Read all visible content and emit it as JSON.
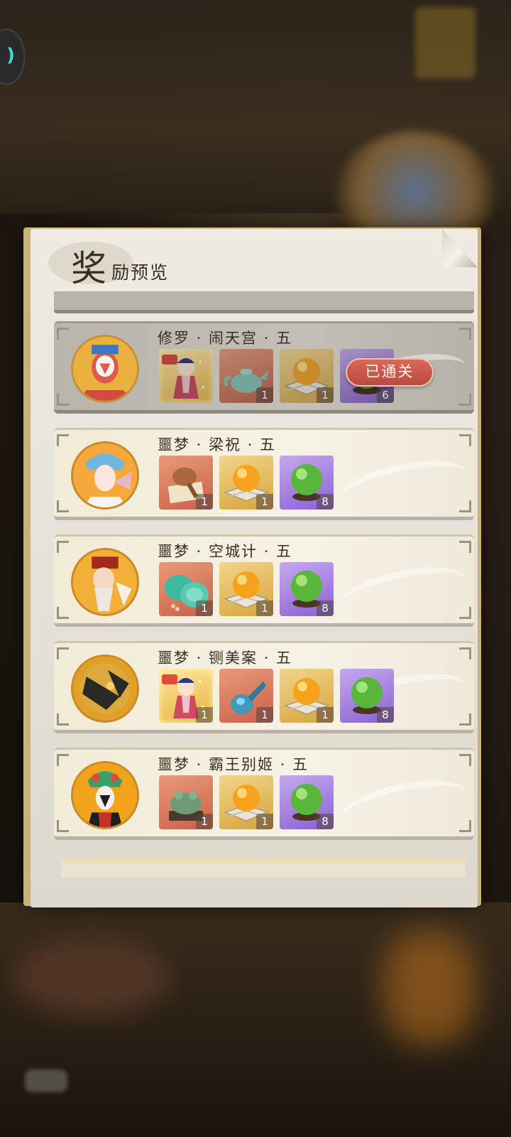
{
  "title": {
    "big_char": "奖",
    "rest": "励预览"
  },
  "back_button": {
    "glyph": ")"
  },
  "stages": [
    {
      "name": "修罗 · 闹天宫 · 五",
      "cleared": true,
      "cleared_label": "已通关",
      "avatar": "sun-wukong-opera-mask",
      "rewards": [
        {
          "icon": "opera-character-figurine",
          "rarity": "char",
          "count": ""
        },
        {
          "icon": "jade-teapot",
          "rarity": "orange",
          "count": "1"
        },
        {
          "icon": "amber-orb-on-scroll",
          "rarity": "gold",
          "count": "1"
        },
        {
          "icon": "green-jade-orb",
          "rarity": "purple",
          "count": "6"
        }
      ]
    },
    {
      "name": "噩梦 · 梁祝 · 五",
      "cleared": false,
      "avatar": "liang-zhu-opera-character",
      "rewards": [
        {
          "icon": "wooden-fan-item",
          "rarity": "orange",
          "count": "1"
        },
        {
          "icon": "amber-orb-on-scroll",
          "rarity": "gold",
          "count": "1"
        },
        {
          "icon": "green-jade-orb",
          "rarity": "purple",
          "count": "8"
        }
      ]
    },
    {
      "name": "噩梦 · 空城计 · 五",
      "cleared": false,
      "avatar": "zhuge-liang-opera-character",
      "rewards": [
        {
          "icon": "jade-discs",
          "rarity": "orange",
          "count": "1"
        },
        {
          "icon": "amber-orb-on-scroll",
          "rarity": "gold",
          "count": "1"
        },
        {
          "icon": "green-jade-orb",
          "rarity": "purple",
          "count": "8"
        }
      ]
    },
    {
      "name": "噩梦 · 铡美案 · 五",
      "cleared": false,
      "avatar": "bao-zheng-opera-character",
      "rewards": [
        {
          "icon": "opera-character-figurine",
          "rarity": "char",
          "count": "1"
        },
        {
          "icon": "blue-ceramic-vase",
          "rarity": "orange",
          "count": "1"
        },
        {
          "icon": "amber-orb-on-scroll",
          "rarity": "gold",
          "count": "1"
        },
        {
          "icon": "green-jade-orb",
          "rarity": "purple",
          "count": "8"
        }
      ]
    },
    {
      "name": "噩梦 · 霸王别姬 · 五",
      "cleared": false,
      "avatar": "xiang-yu-opera-character",
      "rewards": [
        {
          "icon": "jade-toad",
          "rarity": "orange",
          "count": "1"
        },
        {
          "icon": "amber-orb-on-scroll",
          "rarity": "gold",
          "count": "1"
        },
        {
          "icon": "green-jade-orb",
          "rarity": "purple",
          "count": "8"
        }
      ]
    }
  ]
}
